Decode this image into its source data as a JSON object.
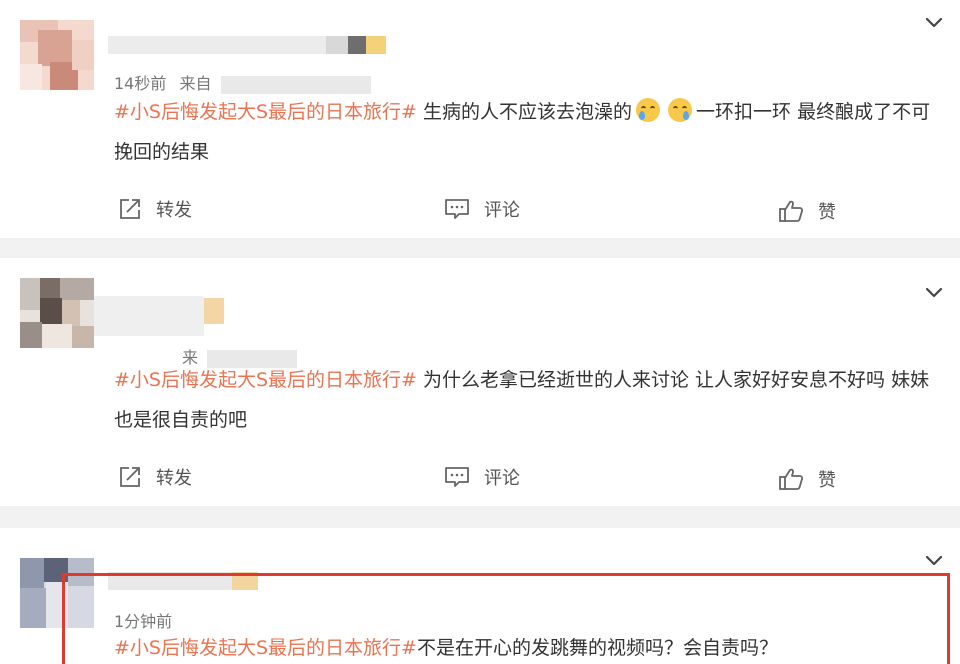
{
  "posts": [
    {
      "time": "14秒前",
      "source_label": "来自",
      "topic": "#小S后悔发起大S最后的日本旅行#",
      "text_before_emoji": "生病的人不应该去泡澡的",
      "emoji": "crying-face",
      "text_after_emoji": "一环扣一环 最终酿成了不可挽回的结果",
      "actions": {
        "repost": "转发",
        "comment": "评论",
        "like": "赞"
      }
    },
    {
      "time": "",
      "source_label": "来",
      "topic": "#小S后悔发起大S最后的日本旅行#",
      "text": "为什么老拿已经逝世的人来讨论 让人家好好安息不好吗 妹妹也是很自责的吧",
      "actions": {
        "repost": "转发",
        "comment": "评论",
        "like": "赞"
      }
    },
    {
      "time": "1分钟前",
      "topic": "#小S后悔发起大S最后的日本旅行#",
      "text": "不是在开心的发跳舞的视频吗？会自责吗？"
    }
  ],
  "icons": {
    "expand": "chevron-down-icon",
    "repost": "repost-icon",
    "comment": "comment-icon",
    "like": "thumbs-up-icon"
  },
  "colors": {
    "topic": "#eb7350",
    "highlight_box": "#e03a2f",
    "page_background": "#f2f2f2"
  }
}
